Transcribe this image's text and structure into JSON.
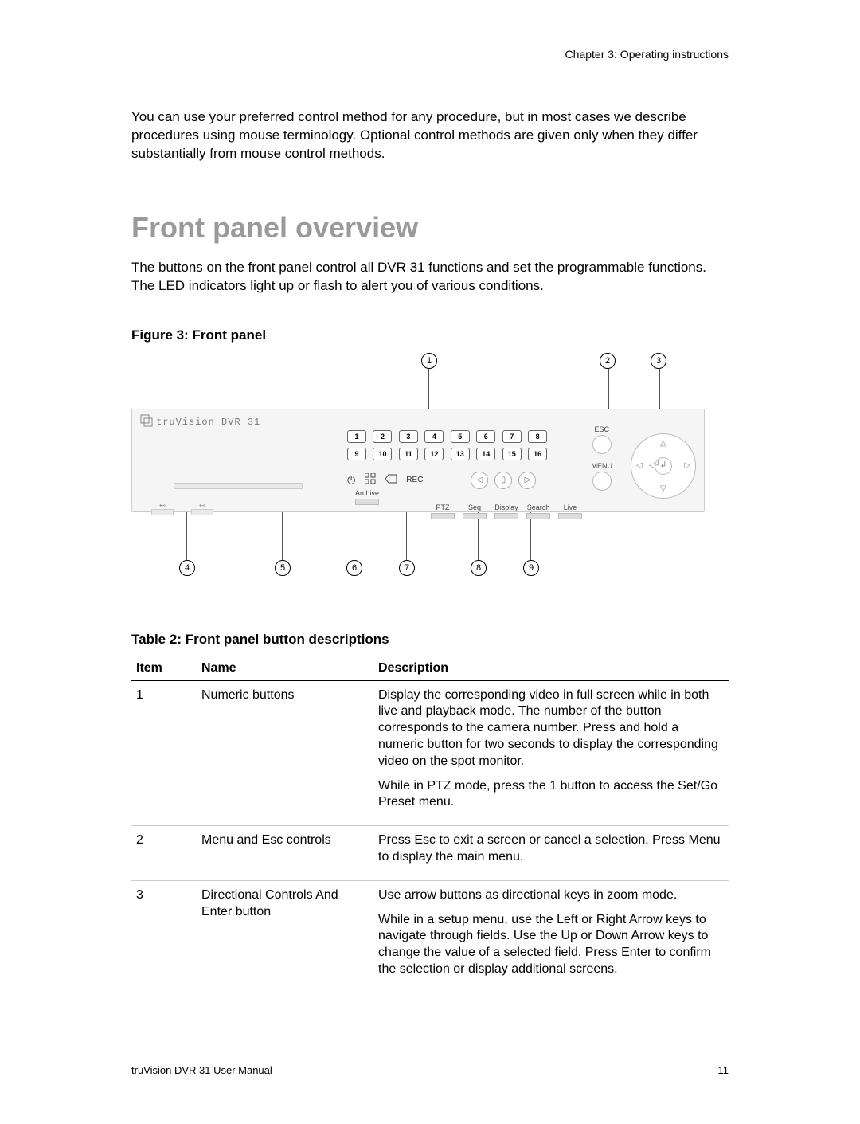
{
  "chapter_header": "Chapter 3: Operating instructions",
  "intro_paragraph": "You can use your preferred control method for any procedure, but in most cases we describe procedures using mouse terminology. Optional control methods are given only when they differ substantially from mouse control methods.",
  "section_title": "Front panel overview",
  "section_paragraph": "The buttons on the front panel control all DVR 31 functions and set the programmable functions. The LED indicators light up or flash to alert you of various conditions.",
  "figure_caption": "Figure 3: Front panel",
  "diagram": {
    "product_name": "truVision DVR 31",
    "numeric_buttons": [
      "1",
      "2",
      "3",
      "4",
      "5",
      "6",
      "7",
      "8",
      "9",
      "10",
      "11",
      "12",
      "13",
      "14",
      "15",
      "16"
    ],
    "rec_label": "REC",
    "archive_label": "Archive",
    "esc_label": "ESC",
    "menu_label": "MENU",
    "bottom_labels": [
      "PTZ",
      "Seq",
      "Display",
      "Search",
      "Live"
    ],
    "callouts": [
      "1",
      "2",
      "3",
      "4",
      "5",
      "6",
      "7",
      "8",
      "9"
    ]
  },
  "table_caption": "Table 2: Front panel button descriptions",
  "table_headers": {
    "item": "Item",
    "name": "Name",
    "description": "Description"
  },
  "table_rows": [
    {
      "item": "1",
      "name": "Numeric buttons",
      "descriptions": [
        "Display the corresponding video in full screen while in both live and playback mode. The number of the button corresponds to the camera number. Press and hold a numeric button for two seconds to display the corresponding video on the spot monitor.",
        "While in PTZ mode, press the 1 button to access the Set/Go Preset menu."
      ]
    },
    {
      "item": "2",
      "name": "Menu and Esc controls",
      "descriptions": [
        "Press Esc to exit a screen or cancel a selection. Press Menu to display the main menu."
      ]
    },
    {
      "item": "3",
      "name": "Directional Controls And Enter button",
      "descriptions": [
        "Use arrow buttons as directional keys in zoom mode.",
        "While in a setup menu, use the Left or Right Arrow keys to navigate through fields. Use the Up or Down Arrow keys to change the value of a selected field. Press Enter to confirm the selection or display additional screens."
      ]
    }
  ],
  "footer_left": "truVision DVR 31 User Manual",
  "footer_right": "11"
}
